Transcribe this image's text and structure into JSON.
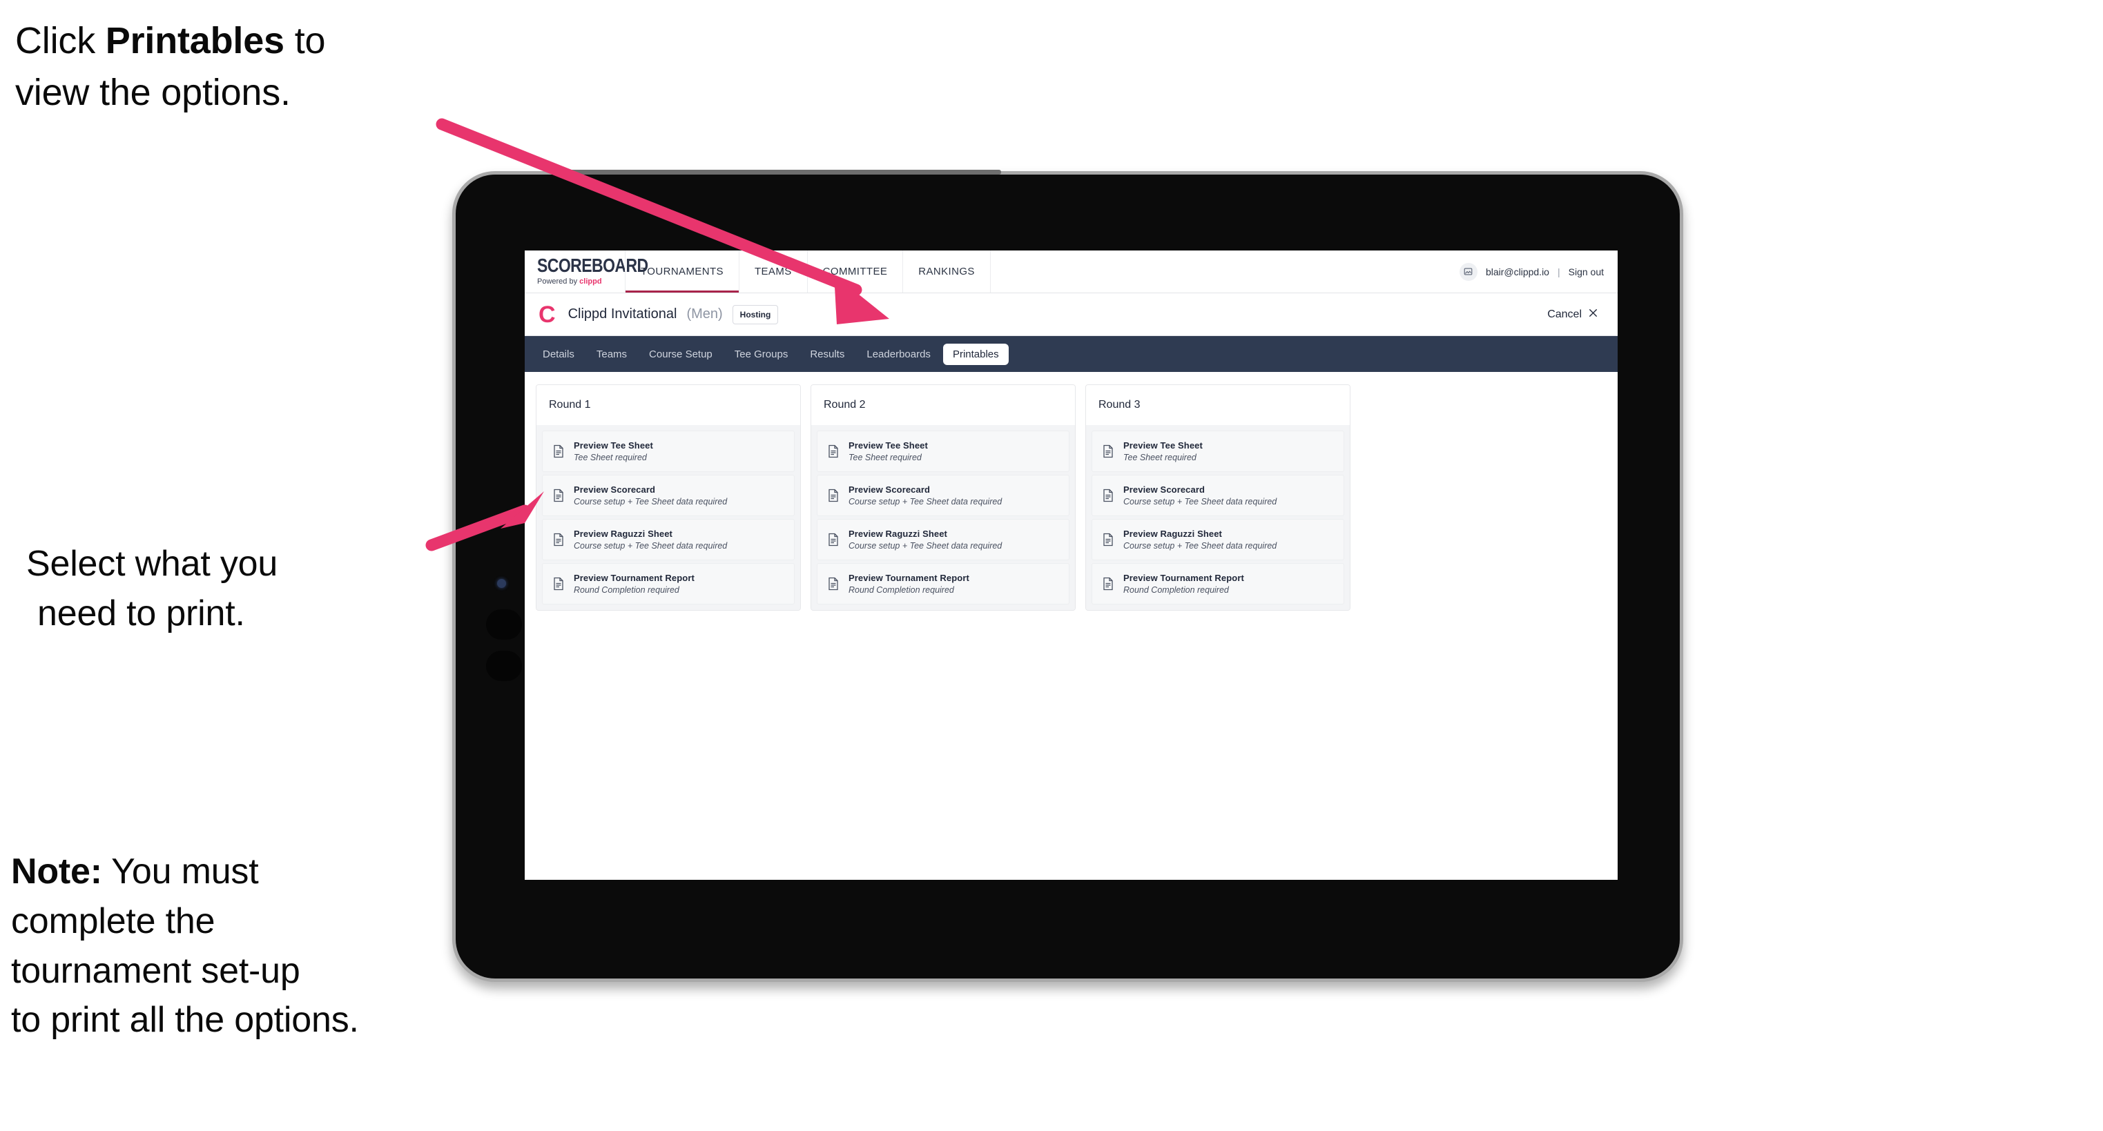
{
  "annotations": {
    "click_printables": {
      "pre": "Click ",
      "bold": "Printables",
      "post": " to",
      "line2": "view the options."
    },
    "select_print": {
      "line1": "Select what you",
      "line2": "need to print."
    },
    "note": {
      "label": "Note:",
      "line1_rest": " You must",
      "line2": "complete the",
      "line3": "tournament set-up",
      "line4": "to print all the options."
    },
    "arrow_color": "#e8356d"
  },
  "app": {
    "brand": {
      "word": "SCOREBOARD",
      "powered_prefix": "Powered by ",
      "powered_name": "clippd"
    },
    "topnav": [
      {
        "label": "TOURNAMENTS",
        "active": true
      },
      {
        "label": "TEAMS",
        "active": false
      },
      {
        "label": "COMMITTEE",
        "active": false
      },
      {
        "label": "RANKINGS",
        "active": false
      }
    ],
    "account": {
      "avatar_icon": "user-image-icon",
      "email": "blair@clippd.io",
      "separator": "|",
      "sign_out": "Sign out"
    },
    "tournament": {
      "logo_letter": "C",
      "name": "Clippd Invitational",
      "gender": "(Men)",
      "hosting_badge": "Hosting",
      "cancel_label": "Cancel",
      "cancel_icon": "close-x-icon"
    },
    "tabs": [
      {
        "label": "Details",
        "active": false
      },
      {
        "label": "Teams",
        "active": false
      },
      {
        "label": "Course Setup",
        "active": false
      },
      {
        "label": "Tee Groups",
        "active": false
      },
      {
        "label": "Results",
        "active": false
      },
      {
        "label": "Leaderboards",
        "active": false
      },
      {
        "label": "Printables",
        "active": true
      }
    ],
    "rounds": [
      {
        "title": "Round 1",
        "items": [
          {
            "title": "Preview Tee Sheet",
            "subtitle": "Tee Sheet required",
            "icon": "document-icon"
          },
          {
            "title": "Preview Scorecard",
            "subtitle": "Course setup + Tee Sheet data required",
            "icon": "document-icon"
          },
          {
            "title": "Preview Raguzzi Sheet",
            "subtitle": "Course setup + Tee Sheet data required",
            "icon": "document-icon"
          },
          {
            "title": "Preview Tournament Report",
            "subtitle": "Round Completion required",
            "icon": "document-icon"
          }
        ]
      },
      {
        "title": "Round 2",
        "items": [
          {
            "title": "Preview Tee Sheet",
            "subtitle": "Tee Sheet required",
            "icon": "document-icon"
          },
          {
            "title": "Preview Scorecard",
            "subtitle": "Course setup + Tee Sheet data required",
            "icon": "document-icon"
          },
          {
            "title": "Preview Raguzzi Sheet",
            "subtitle": "Course setup + Tee Sheet data required",
            "icon": "document-icon"
          },
          {
            "title": "Preview Tournament Report",
            "subtitle": "Round Completion required",
            "icon": "document-icon"
          }
        ]
      },
      {
        "title": "Round 3",
        "items": [
          {
            "title": "Preview Tee Sheet",
            "subtitle": "Tee Sheet required",
            "icon": "document-icon"
          },
          {
            "title": "Preview Scorecard",
            "subtitle": "Course setup + Tee Sheet data required",
            "icon": "document-icon"
          },
          {
            "title": "Preview Raguzzi Sheet",
            "subtitle": "Course setup + Tee Sheet data required",
            "icon": "document-icon"
          },
          {
            "title": "Preview Tournament Report",
            "subtitle": "Round Completion required",
            "icon": "document-icon"
          }
        ]
      }
    ]
  },
  "colors": {
    "accent_pink": "#e8356d",
    "tabstrip_navy": "#2f3b52",
    "text_dark": "#21283a"
  }
}
